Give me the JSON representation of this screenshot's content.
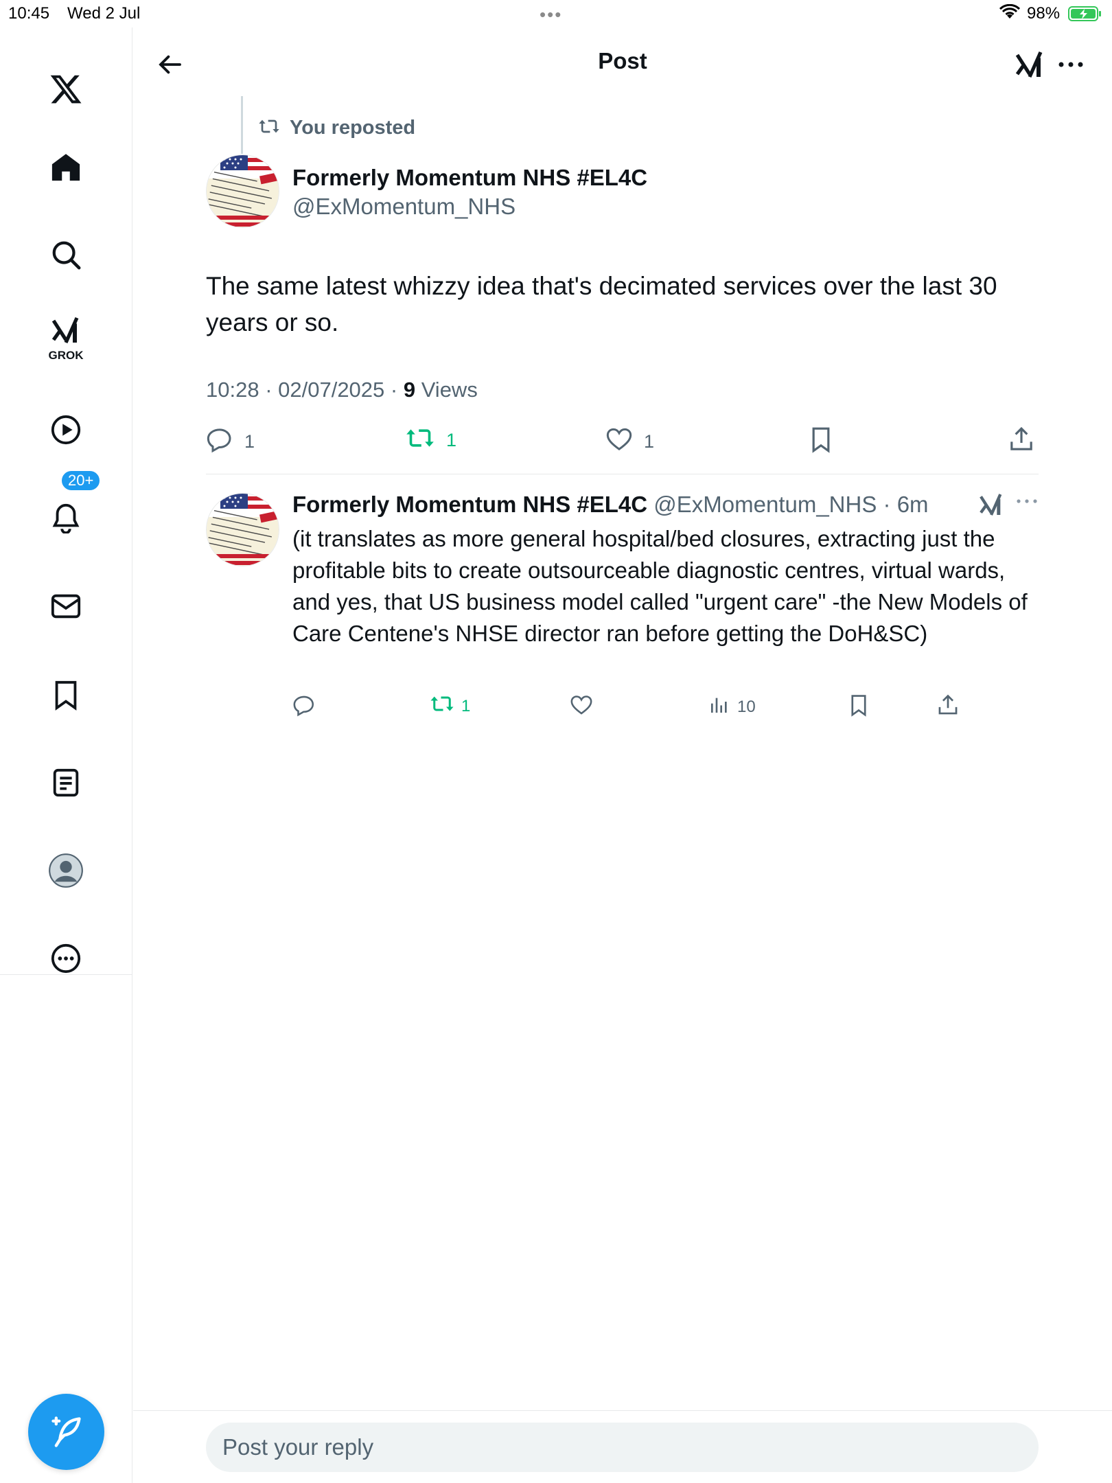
{
  "status_bar": {
    "time": "10:45",
    "date": "Wed 2 Jul",
    "battery_percent": "98%",
    "battery_level": 0.98
  },
  "sidebar": {
    "items": [
      {
        "name": "x-logo-icon"
      },
      {
        "name": "home-icon"
      },
      {
        "name": "search-icon"
      },
      {
        "name": "grok-icon",
        "label": "GROK"
      },
      {
        "name": "video-icon"
      },
      {
        "name": "notifications-icon",
        "badge": "20+"
      },
      {
        "name": "messages-icon"
      },
      {
        "name": "bookmarks-icon"
      },
      {
        "name": "lists-icon"
      },
      {
        "name": "profile-icon"
      },
      {
        "name": "more-icon"
      }
    ]
  },
  "header": {
    "title": "Post"
  },
  "post": {
    "repost_label": "You reposted",
    "author_name": "Formerly Momentum NHS #EL4C",
    "author_handle": "@ExMomentum_NHS",
    "text": "The same latest whizzy idea that's decimated services over the last 30 years or so.",
    "time": "10:28 · 02/07/2025 · ",
    "views_count": "9",
    "views_label": " Views",
    "replies": "1",
    "reposts": "1",
    "likes": "1"
  },
  "reply": {
    "author_name": "Formerly Momentum NHS #EL4C",
    "author_handle": "@ExMomentum_NHS",
    "age": "6m",
    "text": "(it translates as more general hospital/bed closures, extracting just the profitable bits to create outsourceable diagnostic centres, virtual wards, and yes, that US business model called \"urgent care\" -the New Models of Care Centene's NHSE director ran before getting the DoH&SC)",
    "reposts": "1",
    "views": "10"
  },
  "composer": {
    "placeholder": "Post your reply"
  },
  "colors": {
    "accent": "#1d9bf0",
    "repost_green": "#00ba7c",
    "secondary_text": "#536471",
    "divider": "#e7e9ea"
  }
}
